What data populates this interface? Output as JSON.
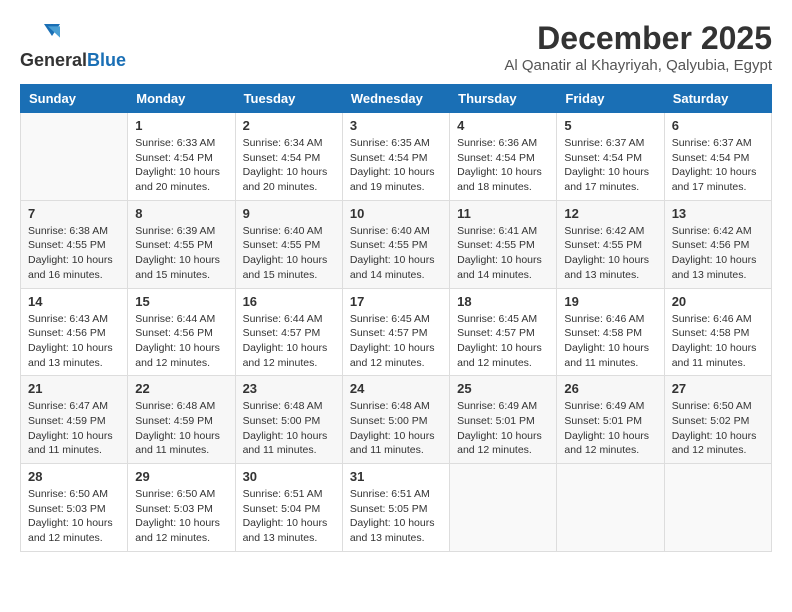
{
  "header": {
    "logo": {
      "general": "General",
      "blue": "Blue"
    },
    "title": "December 2025",
    "location": "Al Qanatir al Khayriyah, Qalyubia, Egypt"
  },
  "weekdays": [
    "Sunday",
    "Monday",
    "Tuesday",
    "Wednesday",
    "Thursday",
    "Friday",
    "Saturday"
  ],
  "weeks": [
    [
      {
        "day": "",
        "info": ""
      },
      {
        "day": "1",
        "info": "Sunrise: 6:33 AM\nSunset: 4:54 PM\nDaylight: 10 hours\nand 20 minutes."
      },
      {
        "day": "2",
        "info": "Sunrise: 6:34 AM\nSunset: 4:54 PM\nDaylight: 10 hours\nand 20 minutes."
      },
      {
        "day": "3",
        "info": "Sunrise: 6:35 AM\nSunset: 4:54 PM\nDaylight: 10 hours\nand 19 minutes."
      },
      {
        "day": "4",
        "info": "Sunrise: 6:36 AM\nSunset: 4:54 PM\nDaylight: 10 hours\nand 18 minutes."
      },
      {
        "day": "5",
        "info": "Sunrise: 6:37 AM\nSunset: 4:54 PM\nDaylight: 10 hours\nand 17 minutes."
      },
      {
        "day": "6",
        "info": "Sunrise: 6:37 AM\nSunset: 4:54 PM\nDaylight: 10 hours\nand 17 minutes."
      }
    ],
    [
      {
        "day": "7",
        "info": "Sunrise: 6:38 AM\nSunset: 4:55 PM\nDaylight: 10 hours\nand 16 minutes."
      },
      {
        "day": "8",
        "info": "Sunrise: 6:39 AM\nSunset: 4:55 PM\nDaylight: 10 hours\nand 15 minutes."
      },
      {
        "day": "9",
        "info": "Sunrise: 6:40 AM\nSunset: 4:55 PM\nDaylight: 10 hours\nand 15 minutes."
      },
      {
        "day": "10",
        "info": "Sunrise: 6:40 AM\nSunset: 4:55 PM\nDaylight: 10 hours\nand 14 minutes."
      },
      {
        "day": "11",
        "info": "Sunrise: 6:41 AM\nSunset: 4:55 PM\nDaylight: 10 hours\nand 14 minutes."
      },
      {
        "day": "12",
        "info": "Sunrise: 6:42 AM\nSunset: 4:55 PM\nDaylight: 10 hours\nand 13 minutes."
      },
      {
        "day": "13",
        "info": "Sunrise: 6:42 AM\nSunset: 4:56 PM\nDaylight: 10 hours\nand 13 minutes."
      }
    ],
    [
      {
        "day": "14",
        "info": "Sunrise: 6:43 AM\nSunset: 4:56 PM\nDaylight: 10 hours\nand 13 minutes."
      },
      {
        "day": "15",
        "info": "Sunrise: 6:44 AM\nSunset: 4:56 PM\nDaylight: 10 hours\nand 12 minutes."
      },
      {
        "day": "16",
        "info": "Sunrise: 6:44 AM\nSunset: 4:57 PM\nDaylight: 10 hours\nand 12 minutes."
      },
      {
        "day": "17",
        "info": "Sunrise: 6:45 AM\nSunset: 4:57 PM\nDaylight: 10 hours\nand 12 minutes."
      },
      {
        "day": "18",
        "info": "Sunrise: 6:45 AM\nSunset: 4:57 PM\nDaylight: 10 hours\nand 12 minutes."
      },
      {
        "day": "19",
        "info": "Sunrise: 6:46 AM\nSunset: 4:58 PM\nDaylight: 10 hours\nand 11 minutes."
      },
      {
        "day": "20",
        "info": "Sunrise: 6:46 AM\nSunset: 4:58 PM\nDaylight: 10 hours\nand 11 minutes."
      }
    ],
    [
      {
        "day": "21",
        "info": "Sunrise: 6:47 AM\nSunset: 4:59 PM\nDaylight: 10 hours\nand 11 minutes."
      },
      {
        "day": "22",
        "info": "Sunrise: 6:48 AM\nSunset: 4:59 PM\nDaylight: 10 hours\nand 11 minutes."
      },
      {
        "day": "23",
        "info": "Sunrise: 6:48 AM\nSunset: 5:00 PM\nDaylight: 10 hours\nand 11 minutes."
      },
      {
        "day": "24",
        "info": "Sunrise: 6:48 AM\nSunset: 5:00 PM\nDaylight: 10 hours\nand 11 minutes."
      },
      {
        "day": "25",
        "info": "Sunrise: 6:49 AM\nSunset: 5:01 PM\nDaylight: 10 hours\nand 12 minutes."
      },
      {
        "day": "26",
        "info": "Sunrise: 6:49 AM\nSunset: 5:01 PM\nDaylight: 10 hours\nand 12 minutes."
      },
      {
        "day": "27",
        "info": "Sunrise: 6:50 AM\nSunset: 5:02 PM\nDaylight: 10 hours\nand 12 minutes."
      }
    ],
    [
      {
        "day": "28",
        "info": "Sunrise: 6:50 AM\nSunset: 5:03 PM\nDaylight: 10 hours\nand 12 minutes."
      },
      {
        "day": "29",
        "info": "Sunrise: 6:50 AM\nSunset: 5:03 PM\nDaylight: 10 hours\nand 12 minutes."
      },
      {
        "day": "30",
        "info": "Sunrise: 6:51 AM\nSunset: 5:04 PM\nDaylight: 10 hours\nand 13 minutes."
      },
      {
        "day": "31",
        "info": "Sunrise: 6:51 AM\nSunset: 5:05 PM\nDaylight: 10 hours\nand 13 minutes."
      },
      {
        "day": "",
        "info": ""
      },
      {
        "day": "",
        "info": ""
      },
      {
        "day": "",
        "info": ""
      }
    ]
  ]
}
